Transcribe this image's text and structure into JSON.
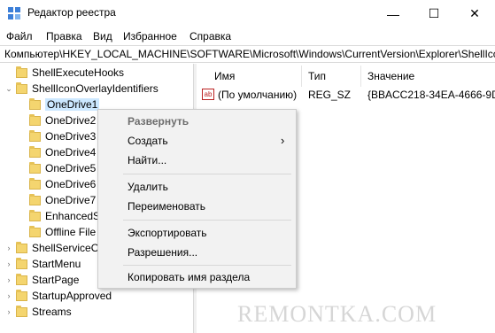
{
  "window": {
    "title": "Редактор реестра",
    "icon": "registry-editor-icon",
    "controls": {
      "minimize": "—",
      "maximize": "☐",
      "close": "✕"
    }
  },
  "menu": [
    "Файл",
    "Правка",
    "Вид",
    "Избранное",
    "Справка"
  ],
  "address": "Компьютер\\HKEY_LOCAL_MACHINE\\SOFTWARE\\Microsoft\\Windows\\CurrentVersion\\Explorer\\ShellIcc",
  "tree": {
    "items": [
      {
        "label": "ShellExecuteHooks",
        "arrow": ""
      },
      {
        "label": "ShellIconOverlayIdentifiers",
        "arrow": "⌄"
      },
      {
        "label": "OneDrive1",
        "arrow": "",
        "selected": true
      },
      {
        "label": "OneDrive2",
        "arrow": ""
      },
      {
        "label": "OneDrive3",
        "arrow": ""
      },
      {
        "label": "OneDrive4",
        "arrow": ""
      },
      {
        "label": "OneDrive5",
        "arrow": ""
      },
      {
        "label": "OneDrive6",
        "arrow": ""
      },
      {
        "label": "OneDrive7",
        "arrow": ""
      },
      {
        "label": "EnhancedS",
        "arrow": ""
      },
      {
        "label": "Offline File",
        "arrow": ""
      },
      {
        "label": "ShellServiceO",
        "arrow": "›"
      },
      {
        "label": "StartMenu",
        "arrow": "›"
      },
      {
        "label": "StartPage",
        "arrow": "›"
      },
      {
        "label": "StartupApproved",
        "arrow": "›"
      },
      {
        "label": "Streams",
        "arrow": "›"
      }
    ]
  },
  "list": {
    "columns": [
      "Имя",
      "Тип",
      "Значение"
    ],
    "rows": [
      {
        "icon": "ab",
        "name": "(По умолчанию)",
        "type": "REG_SZ",
        "value": "{BBACC218-34EA-4666-9D7"
      }
    ]
  },
  "context_menu": {
    "items": [
      {
        "label": "Развернуть",
        "disabled": true
      },
      {
        "label": "Создать",
        "submenu": "›"
      },
      {
        "label": "Найти..."
      },
      {
        "label": "Удалить"
      },
      {
        "label": "Переименовать"
      },
      {
        "label": "Экспортировать"
      },
      {
        "label": "Разрешения..."
      },
      {
        "label": "Копировать имя раздела"
      }
    ]
  },
  "watermark": "REMONTKA.COM"
}
